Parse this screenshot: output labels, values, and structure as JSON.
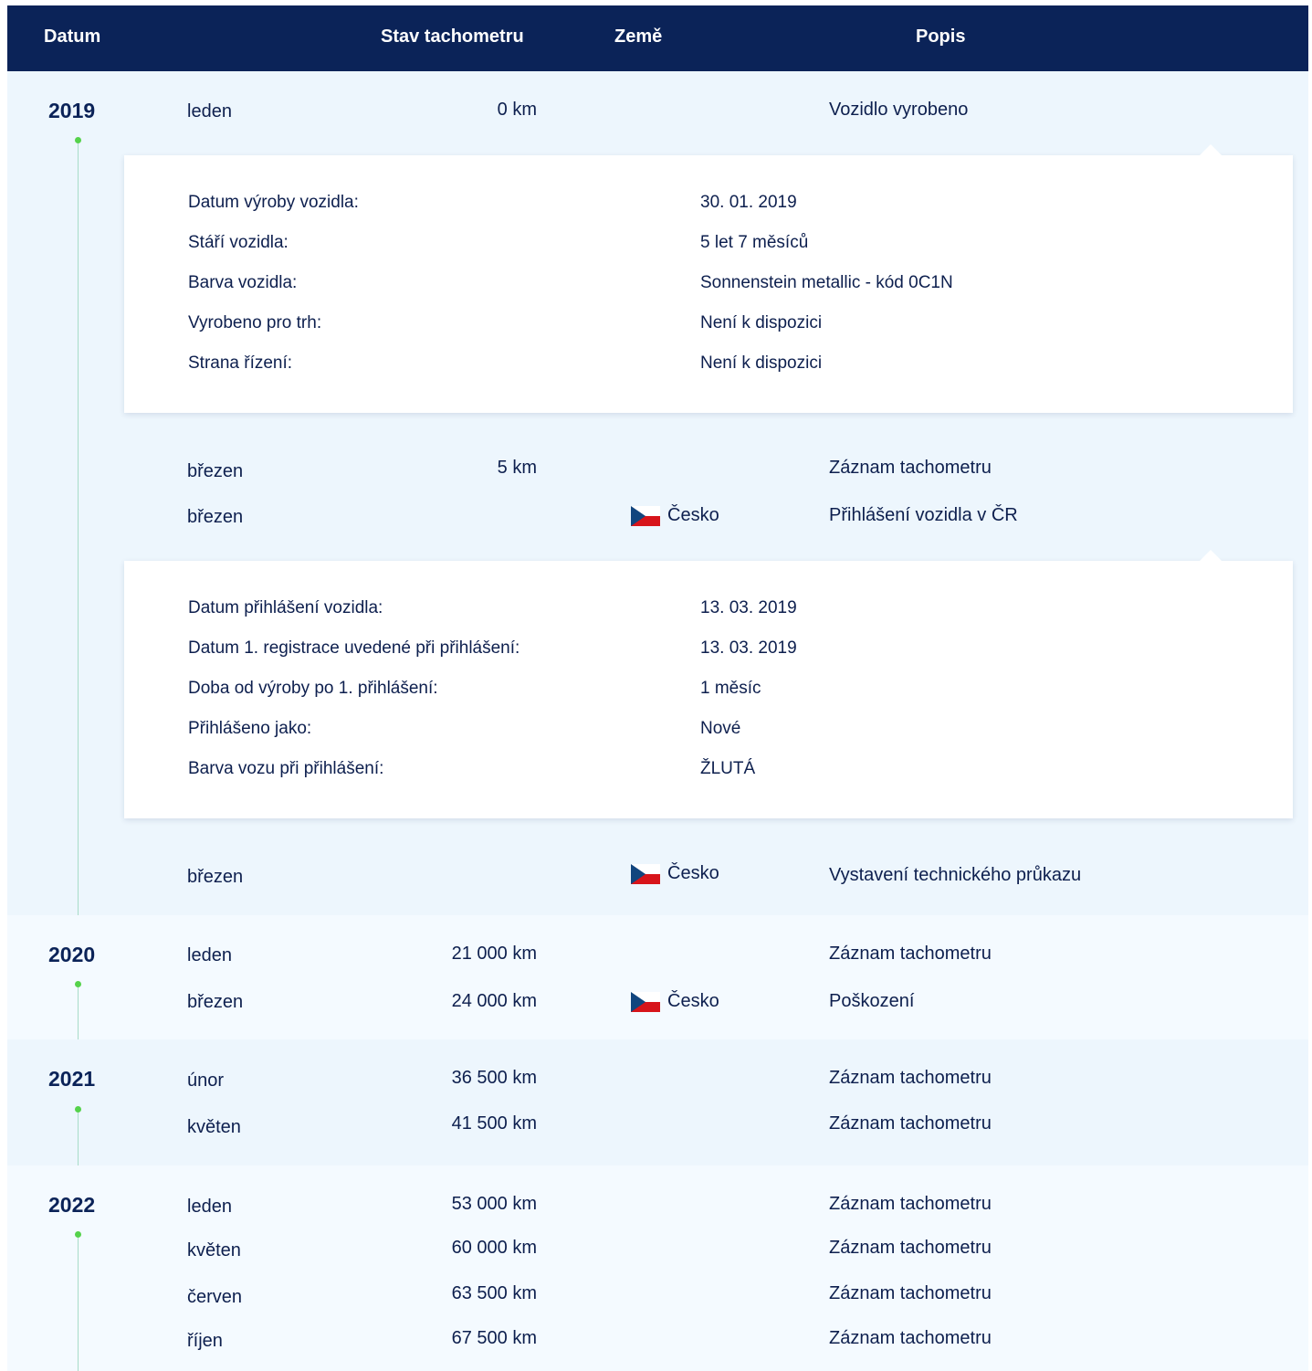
{
  "header": {
    "date": "Datum",
    "odometer": "Stav tachometru",
    "country": "Země",
    "description": "Popis"
  },
  "years": [
    {
      "year": "2019",
      "rows": [
        {
          "month": "leden",
          "km": "0 km",
          "country": "",
          "desc": "Vozidlo vyrobeno"
        },
        {
          "month": "březen",
          "km": "5 km",
          "country": "",
          "desc": "Záznam tachometru"
        },
        {
          "month": "březen",
          "km": "",
          "country": "Česko",
          "desc": "Přihlášení vozidla v ČR"
        },
        {
          "month": "březen",
          "km": "",
          "country": "Česko",
          "desc": "Vystavení technického průkazu"
        }
      ]
    },
    {
      "year": "2020",
      "rows": [
        {
          "month": "leden",
          "km": "21 000 km",
          "country": "",
          "desc": "Záznam tachometru"
        },
        {
          "month": "březen",
          "km": "24 000 km",
          "country": "Česko",
          "desc": "Poškození"
        }
      ]
    },
    {
      "year": "2021",
      "rows": [
        {
          "month": "únor",
          "km": "36 500 km",
          "country": "",
          "desc": "Záznam tachometru"
        },
        {
          "month": "květen",
          "km": "41 500 km",
          "country": "",
          "desc": "Záznam tachometru"
        }
      ]
    },
    {
      "year": "2022",
      "rows": [
        {
          "month": "leden",
          "km": "53 000 km",
          "country": "",
          "desc": "Záznam tachometru"
        },
        {
          "month": "květen",
          "km": "60 000 km",
          "country": "",
          "desc": "Záznam tachometru"
        },
        {
          "month": "červen",
          "km": "63 500 km",
          "country": "",
          "desc": "Záznam tachometru"
        },
        {
          "month": "říjen",
          "km": "67 500 km",
          "country": "",
          "desc": "Záznam tachometru"
        }
      ]
    }
  ],
  "production_details": [
    {
      "label": "Datum výroby vozidla:",
      "value": "30. 01. 2019"
    },
    {
      "label": "Stáří vozidla:",
      "value": "5 let 7 měsíců"
    },
    {
      "label": "Barva vozidla:",
      "value": "Sonnenstein metallic - kód 0C1N"
    },
    {
      "label": "Vyrobeno pro trh:",
      "value": "Není k dispozici"
    },
    {
      "label": "Strana řízení:",
      "value": "Není k dispozici"
    }
  ],
  "registration_details": [
    {
      "label": "Datum přihlášení vozidla:",
      "value": "13. 03. 2019"
    },
    {
      "label": "Datum 1. registrace uvedené při přihlášení:",
      "value": "13. 03. 2019"
    },
    {
      "label": "Doba od výroby po 1. přihlášení:",
      "value": "1 měsíc"
    },
    {
      "label": "Přihlášeno jako:",
      "value": "Nové"
    },
    {
      "label": "Barva vozu při přihlášení:",
      "value": "ŽLUTÁ"
    }
  ],
  "icons": {
    "flag": "czech-flag-icon"
  },
  "colors": {
    "header_bg": "#0b2358",
    "timeline_dot": "#55d24b",
    "row_bg_a": "#edf6fd",
    "row_bg_b": "#f4faff"
  }
}
